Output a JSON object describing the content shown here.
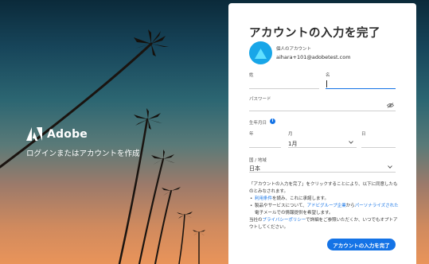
{
  "brand": {
    "name": "Adobe",
    "tagline": "ログインまたはアカウントを作成"
  },
  "card": {
    "title": "アカウントの入力を完了",
    "account": {
      "type_label": "個人のアカウント",
      "email": "aihara+101@adobetest.com"
    },
    "last_name_label": "姓",
    "first_name_label": "名",
    "password_label": "パスワード",
    "birthdate": {
      "label": "生年月日",
      "year_label": "年",
      "month_label": "月",
      "month_value": "1月",
      "day_label": "日"
    },
    "country": {
      "label": "国 / 地域",
      "value": "日本"
    },
    "legal": {
      "intro": "「アカウントの入力を完了」をクリックすることにより、以下に同意したものとみなされます。",
      "b1_link": "利用条件",
      "b1_rest": "を読み、これに承諾します。",
      "b2_pre": "製品やサービスについて、",
      "b2_link1": "アドビグループ企業",
      "b2_mid": "から",
      "b2_link2": "パーソナライズされた",
      "b2_rest": "電子メールでの情報提供を希望します。",
      "p_pre": "当社の",
      "p_link": "プライバシーポリシー",
      "p_rest": "で詳細をご参照いただくか、いつでもオプトアウトしてください。"
    },
    "submit_label": "アカウントの入力を完了"
  },
  "colors": {
    "accent": "#1473e6",
    "avatar": "#18a6e8"
  },
  "icons": {
    "logo": "adobe-logo-icon",
    "password_toggle": "eye-off-icon",
    "info": "info-icon",
    "chevron": "chevron-down-icon"
  }
}
